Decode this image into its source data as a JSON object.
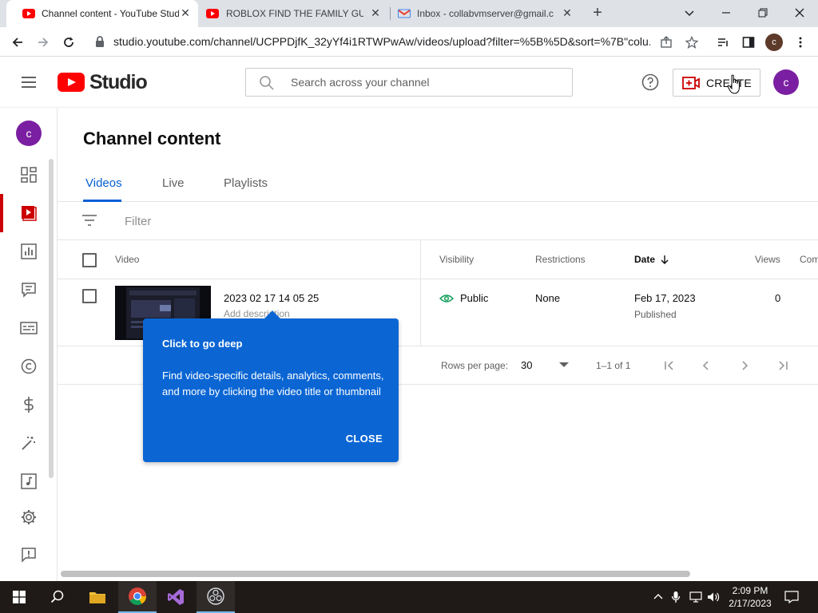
{
  "browser": {
    "tabs": [
      {
        "title": "Channel content - YouTube Stud",
        "favicon": "youtube-icon",
        "active": true
      },
      {
        "title": "ROBLOX FIND THE FAMILY GUY...",
        "favicon": "youtube-icon",
        "active": false
      },
      {
        "title": "Inbox - collabvmserver@gmail.c",
        "favicon": "gmail-icon",
        "active": false
      }
    ],
    "new_tab": "+",
    "url": "studio.youtube.com/channel/UCPPDjfK_32yYf4i1RTWPwAw/videos/upload?filter=%5B%5D&sort=%7B\"colu...",
    "profile_initial": "c"
  },
  "header": {
    "logo_text": "Studio",
    "search_placeholder": "Search across your channel",
    "create_label": "CREATE",
    "avatar_initial": "c"
  },
  "sidebar": {
    "avatar_initial": "c",
    "items": [
      "dashboard-icon",
      "content-icon",
      "analytics-icon",
      "comments-icon",
      "subtitles-icon",
      "copyright-icon",
      "earn-icon",
      "customization-icon",
      "audio-library-icon",
      "settings-icon",
      "feedback-icon"
    ]
  },
  "main": {
    "title": "Channel content",
    "tabs": [
      {
        "label": "Videos",
        "active": true
      },
      {
        "label": "Live",
        "active": false
      },
      {
        "label": "Playlists",
        "active": false
      }
    ],
    "filter_placeholder": "Filter",
    "columns": {
      "video": "Video",
      "visibility": "Visibility",
      "restrictions": "Restrictions",
      "date": "Date",
      "views": "Views",
      "comments": "Com"
    },
    "rows": [
      {
        "title": "2023 02 17 14 05 25",
        "description": "Add description",
        "visibility": "Public",
        "restrictions": "None",
        "date": "Feb 17, 2023",
        "date_status": "Published",
        "views": "0"
      }
    ],
    "pagination": {
      "rows_per_page_label": "Rows per page:",
      "rows_per_page": "30",
      "range": "1–1 of 1"
    }
  },
  "coach_mark": {
    "title": "Click to go deep",
    "body": "Find video-specific details, analytics, comments, and more by clicking the video title or thumbnail",
    "close_label": "CLOSE"
  },
  "taskbar": {
    "time": "2:09 PM",
    "date": "2/17/2023"
  },
  "colors": {
    "youtube_red": "#ff0000",
    "active_blue": "#065fd4",
    "coach_blue": "#0b66d4",
    "avatar_purple": "#7b1fa2"
  }
}
